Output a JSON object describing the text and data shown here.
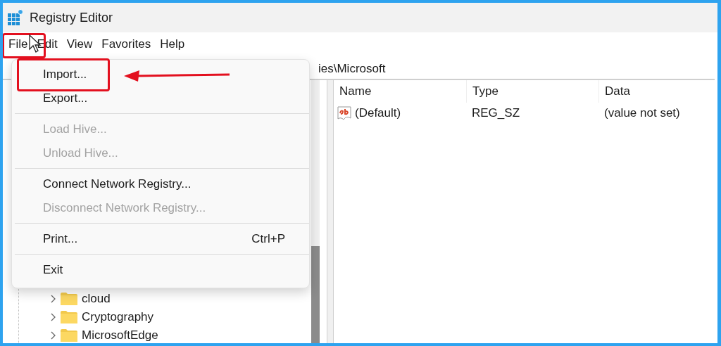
{
  "window": {
    "title": "Registry Editor"
  },
  "menubar": [
    {
      "label": "File"
    },
    {
      "label": "Edit"
    },
    {
      "label": "View"
    },
    {
      "label": "Favorites"
    },
    {
      "label": "Help"
    }
  ],
  "address": "ies\\Microsoft",
  "tree": [
    {
      "label": "cloud"
    },
    {
      "label": "Cryptography"
    },
    {
      "label": "MicrosoftEdge"
    }
  ],
  "values": {
    "columns": [
      "Name",
      "Type",
      "Data"
    ],
    "rows": [
      {
        "name": "(Default)",
        "type": "REG_SZ",
        "data": "(value not set)"
      }
    ]
  },
  "file_menu": {
    "items": [
      {
        "kind": "item",
        "label": "Import...",
        "disabled": false
      },
      {
        "kind": "item",
        "label": "Export...",
        "disabled": false
      },
      {
        "kind": "separator"
      },
      {
        "kind": "item",
        "label": "Load Hive...",
        "disabled": true
      },
      {
        "kind": "item",
        "label": "Unload Hive...",
        "disabled": true
      },
      {
        "kind": "separator"
      },
      {
        "kind": "item",
        "label": "Connect Network Registry...",
        "disabled": false
      },
      {
        "kind": "item",
        "label": "Disconnect Network Registry...",
        "disabled": true
      },
      {
        "kind": "separator"
      },
      {
        "kind": "item",
        "label": "Print...",
        "shortcut": "Ctrl+P",
        "disabled": false
      },
      {
        "kind": "separator"
      },
      {
        "kind": "item",
        "label": "Exit",
        "disabled": false
      }
    ]
  }
}
